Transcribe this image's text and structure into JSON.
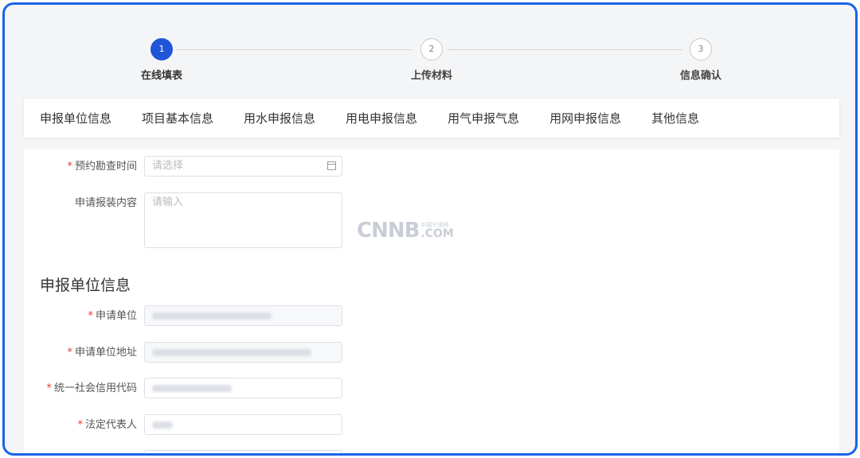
{
  "steps": [
    {
      "number": "1",
      "label": "在线填表",
      "active": true
    },
    {
      "number": "2",
      "label": "上传材料",
      "active": false
    },
    {
      "number": "3",
      "label": "信息确认",
      "active": false
    }
  ],
  "tabs": [
    "申报单位信息",
    "项目基本信息",
    "用水申报信息",
    "用电申报信息",
    "用气申报气息",
    "用网申报信息",
    "其他信息"
  ],
  "form": {
    "survey_time": {
      "label": "预约勘查时间",
      "required": "*",
      "placeholder": "请选择"
    },
    "apply_content": {
      "label": "申请报装内容",
      "placeholder": "请输入"
    }
  },
  "section": {
    "title": "申报单位信息"
  },
  "unit_fields": [
    {
      "label": "申请单位",
      "required": "*"
    },
    {
      "label": "申请单位地址",
      "required": "*"
    },
    {
      "label": "统一社会信用代码",
      "required": "*"
    },
    {
      "label": "法定代表人",
      "required": "*"
    }
  ],
  "watermark": {
    "big": "CNNB",
    "small": "中国宁波网",
    "com": ".COM"
  },
  "colors": {
    "accent": "#2155d8",
    "frame": "#1b63e8",
    "required": "#e53935"
  }
}
